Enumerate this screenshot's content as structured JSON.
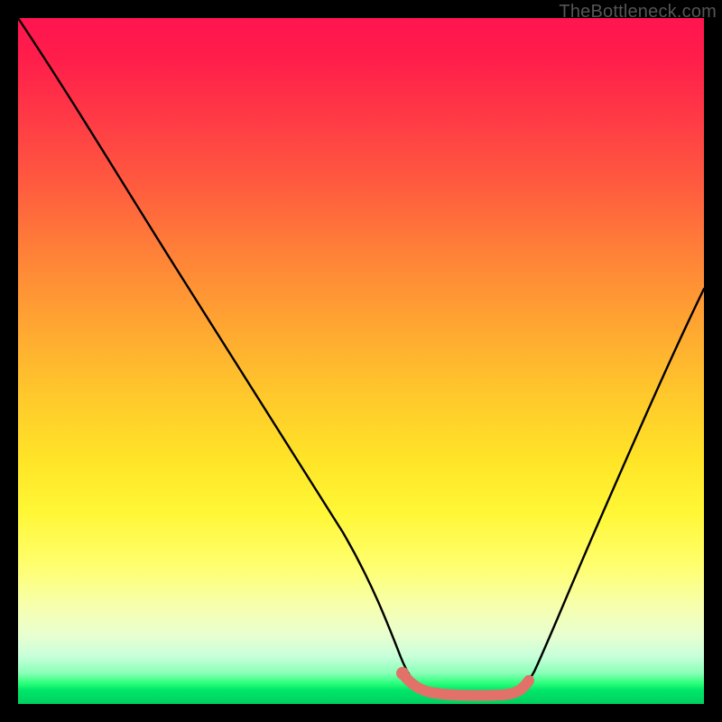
{
  "watermark": "TheBottleneck.com",
  "chart_data": {
    "type": "line",
    "title": "",
    "xlabel": "",
    "ylabel": "",
    "xlim": [
      0,
      100
    ],
    "ylim": [
      0,
      100
    ],
    "background_gradient": {
      "top": "#ff1450",
      "mid": "#ffe327",
      "bottom": "#00d060"
    },
    "series": [
      {
        "name": "black-curve",
        "color": "#000000",
        "x": [
          0,
          6,
          12,
          18,
          24,
          30,
          36,
          42,
          48,
          52,
          55,
          57,
          60,
          66,
          72,
          75,
          78,
          82,
          88,
          94,
          100
        ],
        "y": [
          100,
          90,
          80,
          70,
          60,
          50,
          40,
          30,
          20,
          12,
          6,
          3,
          1.5,
          1.2,
          1.5,
          3,
          8,
          18,
          34,
          52,
          70
        ]
      },
      {
        "name": "pink-segment",
        "color": "#e2716a",
        "x": [
          55,
          57,
          60,
          63,
          66,
          69,
          72,
          74
        ],
        "y": [
          3.5,
          2.2,
          1.5,
          1.2,
          1.2,
          1.3,
          1.6,
          2.6
        ]
      }
    ],
    "markers": [
      {
        "name": "pink-dot-start",
        "x": 55,
        "y": 3.5,
        "color": "#e2716a",
        "r": 6
      }
    ]
  }
}
